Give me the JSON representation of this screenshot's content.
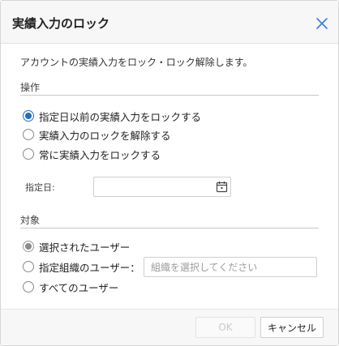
{
  "dialog": {
    "title": "実績入力のロック",
    "description": "アカウントの実績入力をロック・ロック解除します。"
  },
  "operation": {
    "label": "操作",
    "options": [
      {
        "label": "指定日以前の実績入力をロックする",
        "checked": true
      },
      {
        "label": "実績入力のロックを解除する",
        "checked": false
      },
      {
        "label": "常に実績入力をロックする",
        "checked": false
      }
    ]
  },
  "date": {
    "label": "指定日:",
    "value": ""
  },
  "target": {
    "label": "対象",
    "options": [
      {
        "label": "選択されたユーザー",
        "checked": true,
        "disabled": true
      },
      {
        "label": "指定組織のユーザー：",
        "checked": false
      },
      {
        "label": "すべてのユーザー",
        "checked": false
      }
    ],
    "org_placeholder": "組織を選択してください"
  },
  "footer": {
    "ok_label": "OK",
    "cancel_label": "キャンセル"
  },
  "colors": {
    "accent": "#1f6fc9",
    "close_icon": "#3b7dd8"
  }
}
